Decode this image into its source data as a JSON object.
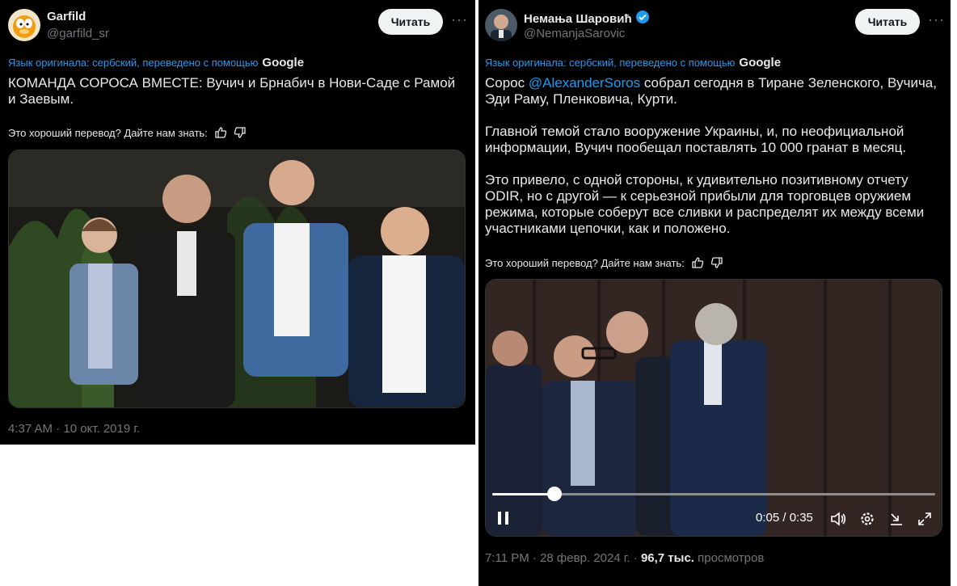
{
  "tweet1": {
    "author_name": "Garfild",
    "author_handle": "@garfild_sr",
    "follow_label": "Читать",
    "more_label": "···",
    "translation_note": "Язык оригинала: сербский, переведено с помощью",
    "translation_brand": "Google",
    "text": "КОМАНДА СОРОСА ВМЕСТЕ: Вучич и Брнабич в Нови-Саде с Рамой и Заевым.",
    "feedback_prompt": "Это хороший перевод? Дайте нам знать:",
    "timestamp": "4:37 AM · 10 окт. 2019 г."
  },
  "tweet2": {
    "author_name": "Немања Шаровић",
    "author_handle": "@NemanjaSarovic",
    "follow_label": "Читать",
    "more_label": "···",
    "translation_note": "Язык оригинала: сербский, переведено с помощью",
    "translation_brand": "Google",
    "text_prefix": "Сорос ",
    "mention": "@AlexanderSoros",
    "text_suffix": " собрал сегодня в Тиране Зеленского, Вучича, Эди Раму, Пленковича, Курти.",
    "paragraph2": "Главной темой стало вооружение Украины, и, по неофициальной информации, Вучич пообещал поставлять 10 000 гранат в месяц.",
    "paragraph3": "Это привело, с одной стороны, к удивительно позитивному отчету ODIR, но с другой — к серьезной прибыли для торговцев оружием режима, которые соберут все сливки и распределят их между всеми участниками цепочки, как и положено.",
    "feedback_prompt": "Это хороший перевод? Дайте нам знать:",
    "video_time": "0:05 / 0:35",
    "video_progress": 0.14,
    "timestamp": "7:11 PM · 28 февр. 2024 г. · ",
    "views_count": "96,7 тыс.",
    "views_label": " просмотров"
  },
  "colors": {
    "accent": "#1d9bf0",
    "background": "#000000",
    "muted": "#71767b",
    "verified": "#1d9bf0"
  },
  "icons": [
    "thumbs-up-icon",
    "thumbs-down-icon",
    "verified-badge-icon",
    "pause-icon",
    "volume-icon",
    "settings-icon",
    "minimize-icon",
    "fullscreen-icon"
  ]
}
